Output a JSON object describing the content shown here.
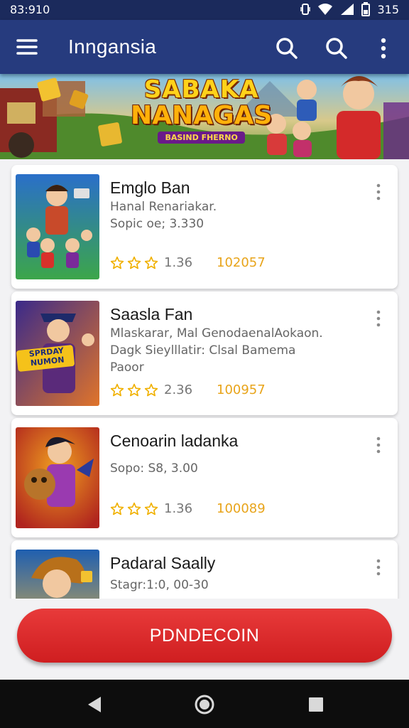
{
  "status_bar": {
    "time": "83:910",
    "battery": "315"
  },
  "app_bar": {
    "title": "Inngansia",
    "icons": [
      "menu-icon",
      "search-icon",
      "search-icon",
      "more-vert-icon"
    ]
  },
  "banner": {
    "headline_line1": "SABAKA",
    "headline_line2": "NANAGAS",
    "tagline": "BASIND FHERNO"
  },
  "games": [
    {
      "title": "Emglo Ban",
      "desc_lines": [
        "Hanal Renariakar.",
        "Sopic oe; 3.330"
      ],
      "rating": "1.36",
      "count": "102057",
      "thumb_colors": [
        "#2a6fc9",
        "#3ca64a"
      ]
    },
    {
      "title": "Saasla Fan",
      "desc_lines": [
        "Mlaskarar, Mal GenodaenalAokaon.",
        "Dagk Sieylllatir: Clsal Bamema",
        "Paoor"
      ],
      "rating": "2.36",
      "count": "100957",
      "thumb_colors": [
        "#3a2a8a",
        "#e0742a"
      ],
      "thumb_text": "SPRDAY NUMON"
    },
    {
      "title": "Cenoarin ladanka",
      "desc_lines": [
        "Sopo: S8, 3.00"
      ],
      "rating": "1.36",
      "count": "100089",
      "thumb_colors": [
        "#b0241e",
        "#f0a020"
      ]
    },
    {
      "title": "Padaral Saally",
      "desc_lines": [
        "Stagr:1:0, 00-30"
      ],
      "rating": "",
      "count": "",
      "thumb_colors": [
        "#1f5fb0",
        "#f2b73a"
      ]
    }
  ],
  "cta": {
    "label": "PDNDECOIN"
  },
  "nav_bar": {
    "icons": [
      "back-icon",
      "home-icon",
      "recents-icon"
    ]
  },
  "colors": {
    "app_bar": "#263b7e",
    "status_bar": "#1b2a5c",
    "accent_red": "#d62226",
    "count_gold": "#e8a41a",
    "star": "#f0b000"
  }
}
